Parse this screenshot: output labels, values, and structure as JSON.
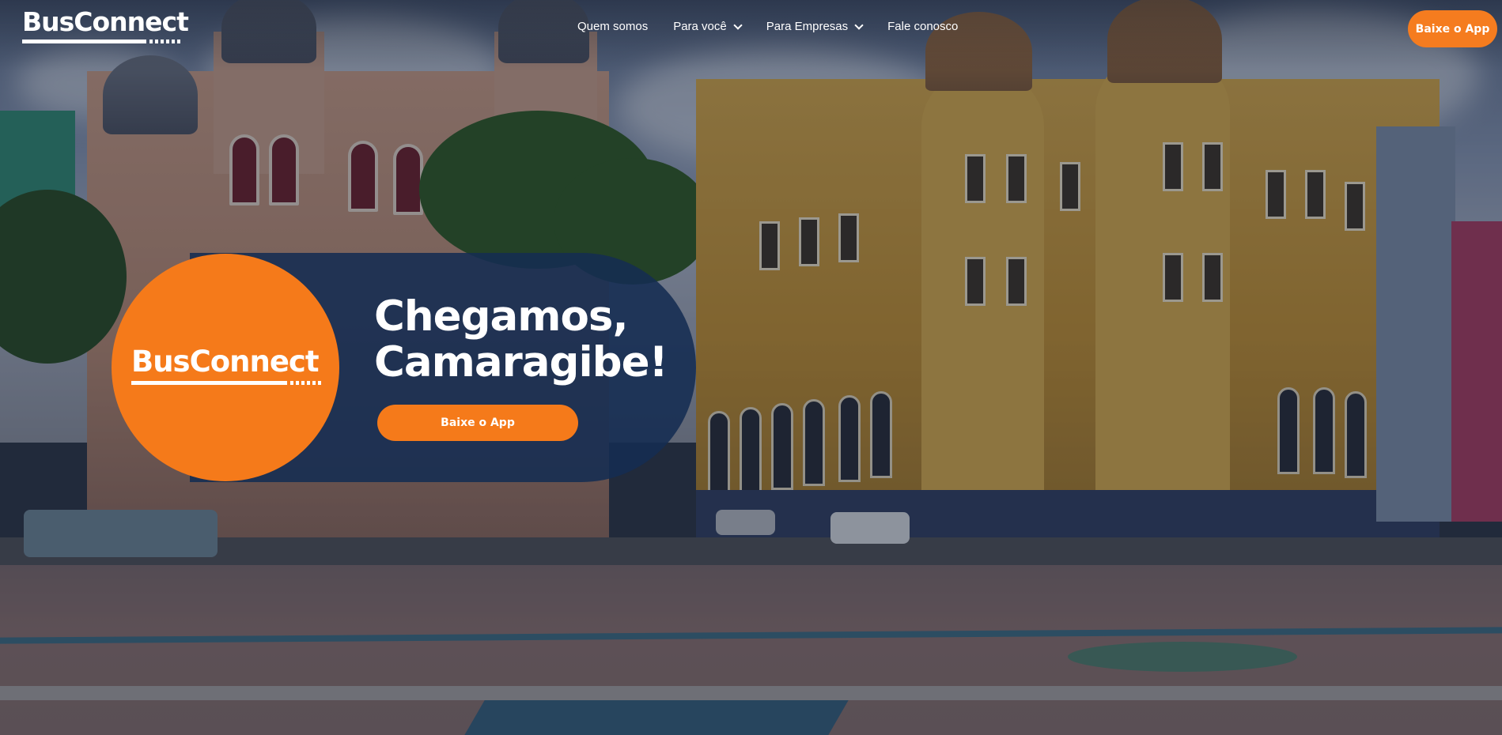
{
  "brand": {
    "name": "BusConnect",
    "accent_color": "#f57a1a",
    "panel_color": "#152c52"
  },
  "header": {
    "nav": [
      {
        "label": "Quem somos",
        "has_dropdown": false
      },
      {
        "label": "Para você",
        "has_dropdown": true
      },
      {
        "label": "Para Empresas",
        "has_dropdown": true
      },
      {
        "label": "Fale conosco",
        "has_dropdown": false
      }
    ],
    "cta_label": "Baixe o App"
  },
  "hero": {
    "logo_text": "BusConnect",
    "title_line1": "Chegamos,",
    "title_line2": "Camaragibe!",
    "cta_label": "Baixe o App"
  }
}
